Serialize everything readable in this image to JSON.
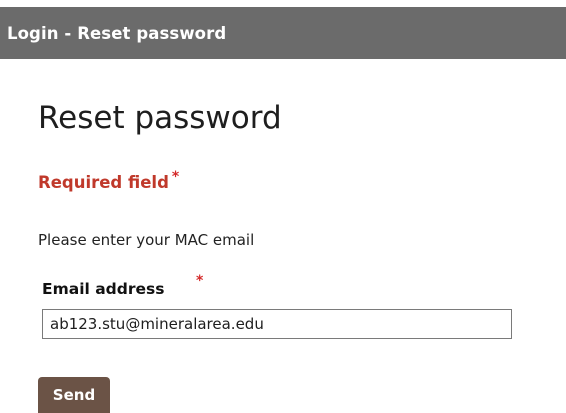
{
  "header": {
    "title": "Login - Reset password"
  },
  "main": {
    "heading": "Reset password",
    "required_legend": "Required field",
    "required_marker": "*",
    "instruction": "Please enter your MAC email",
    "email_field": {
      "label": "Email address",
      "required_marker": "*",
      "value": "ab123.stu@mineralarea.edu"
    },
    "send_label": "Send"
  },
  "colors": {
    "header_background": "#6b6b6b",
    "required_text": "#c0392b",
    "button_background": "#6b5346"
  }
}
